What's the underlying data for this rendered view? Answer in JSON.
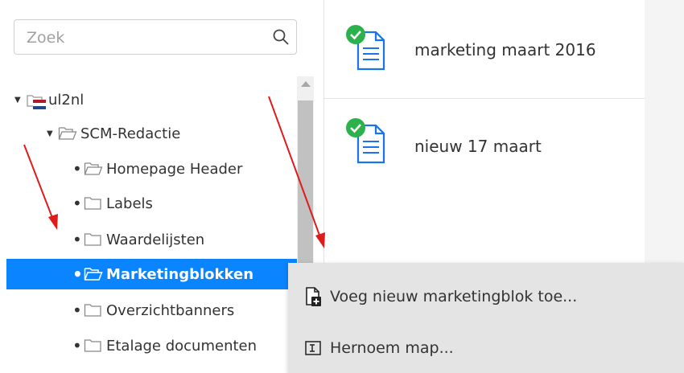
{
  "search": {
    "placeholder": "Zoek",
    "icon": "search-icon"
  },
  "tree": {
    "root": {
      "label": "ul2nl",
      "flag_colors": [
        "#ae1c28",
        "#ffffff",
        "#21468b"
      ]
    },
    "level1": {
      "label": "SCM-Redactie"
    },
    "items": [
      {
        "label": "Homepage Header",
        "icon": "folder-open-icon"
      },
      {
        "label": "Labels",
        "icon": "folder-icon"
      },
      {
        "label": "Waardelijsten",
        "icon": "folder-icon"
      },
      {
        "label": "Marketingblokken",
        "icon": "folder-open-icon",
        "selected": true
      },
      {
        "label": "Overzichtbanners",
        "icon": "folder-icon"
      },
      {
        "label": "Etalage documenten",
        "icon": "folder-icon"
      }
    ]
  },
  "documents": [
    {
      "title": "marketing maart 2016",
      "status": "published"
    },
    {
      "title": "nieuw 17 maart",
      "status": "published"
    }
  ],
  "context_menu": {
    "items": [
      {
        "label": "Voeg nieuw marketingblok toe...",
        "icon": "add-document-icon"
      },
      {
        "label": "Hernoem map...",
        "icon": "rename-icon"
      }
    ]
  },
  "colors": {
    "selection": "#0b84ff",
    "status_ok": "#2bb24c",
    "doc_icon": "#1a73e8",
    "annotation_arrow": "#e01b1b"
  }
}
